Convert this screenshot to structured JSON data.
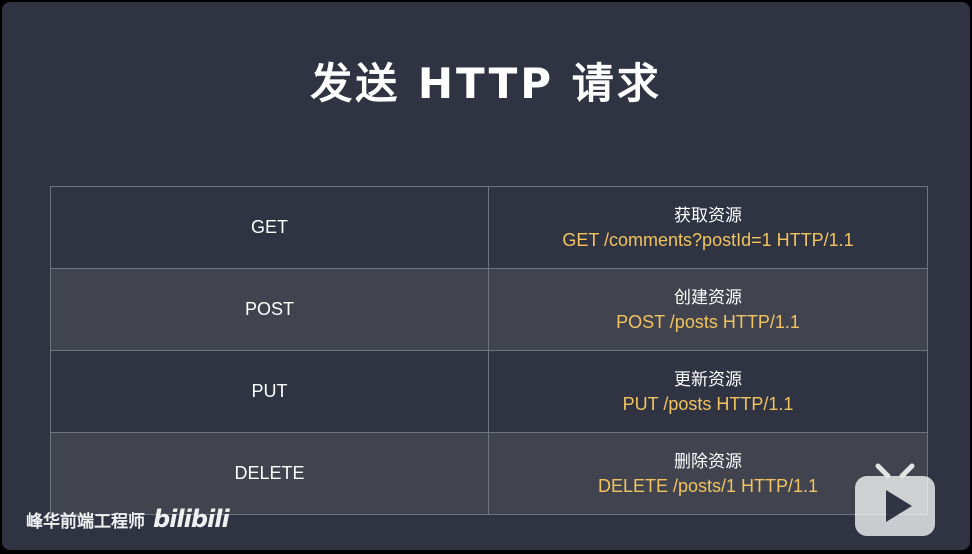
{
  "slide": {
    "title": "发送 HTTP 请求"
  },
  "table": {
    "rows": [
      {
        "method": "GET",
        "desc": "获取资源",
        "request": "GET /comments?postId=1 HTTP/1.1"
      },
      {
        "method": "POST",
        "desc": "创建资源",
        "request": "POST /posts HTTP/1.1"
      },
      {
        "method": "PUT",
        "desc": "更新资源",
        "request": "PUT /posts HTTP/1.1"
      },
      {
        "method": "DELETE",
        "desc": "删除资源",
        "request": "DELETE /posts/1 HTTP/1.1"
      }
    ]
  },
  "watermark": {
    "channel": "峰华前端工程师",
    "logo": "bilibili"
  },
  "colors": {
    "background": "#2f3342",
    "alt_row": "#41444f",
    "accent": "#f2c45f",
    "border": "#70747f"
  },
  "icons": {
    "player": "bilibili-tv-play-icon"
  }
}
